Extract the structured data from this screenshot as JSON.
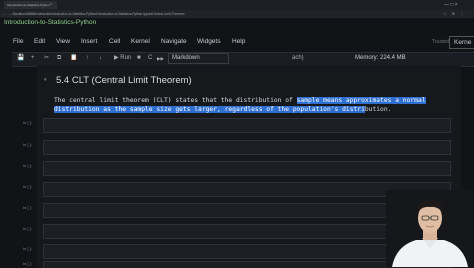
{
  "browser": {
    "tab_title": "Introduction-to-Statistics-Python",
    "tab_close": "×",
    "url": "localhost:8888/notebooks/Introduction-to-Statistics-Python/Introduction-to-Statistics-Python.ipynb#Central-Limit-Theorem",
    "nav": "← → C",
    "icons": "☆ ⊕ ⋮",
    "window_controls": "— □ ×"
  },
  "notebook": {
    "title": "Introduction-to-Statistics-Python",
    "trusted": "Trusted",
    "kernel": "Kerne"
  },
  "menu": [
    "File",
    "Edit",
    "View",
    "Insert",
    "Cell",
    "Kernel",
    "Navigate",
    "Widgets",
    "Help"
  ],
  "toolbar": {
    "buttons": [
      "💾",
      "+",
      "✂",
      "⧉",
      "📋",
      "↑",
      "↓"
    ],
    "run_label": "▶ Run",
    "stop": "■",
    "restart": "C",
    "fastforward": "▶▶",
    "cell_type": "Markdown",
    "trail": "ach)",
    "memory": "Memory: 224.4 MB"
  },
  "cells": {
    "heading": "5.4  CLT (Central Limit Theorem)",
    "md_plain": "The central limit theorem (CLT) states that the distribution of ",
    "md_highlight_1": "sample means approximates a normal",
    "md_highlight_2": "distribution as the sample size gets larger, regardless of the population's distri",
    "md_tail": "bution.",
    "prompt": "In [ ]:",
    "code_cell_count": 8
  },
  "colors": {
    "background": "#111317",
    "highlight": "#2f6fd0",
    "title_green": "#8fd18f"
  }
}
